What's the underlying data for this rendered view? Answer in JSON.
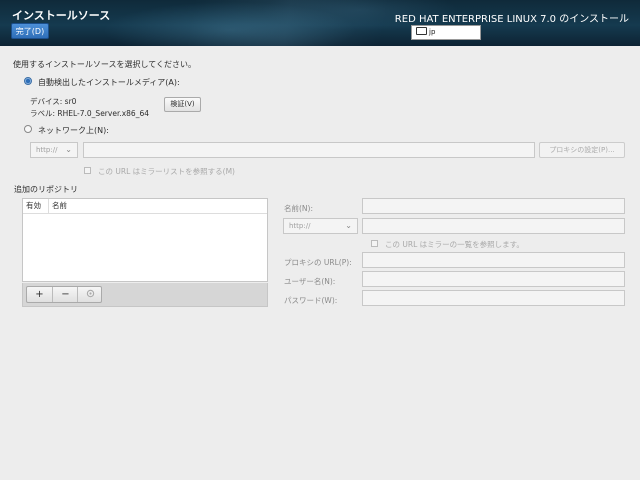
{
  "header": {
    "title": "インストールソース",
    "done_label": "完了(D)",
    "product": "RED HAT ENTERPRISE LINUX 7.0 のインストール",
    "keyboard_layout": "jp"
  },
  "main": {
    "prompt": "使用するインストールソースを選択してください。",
    "auto_media": {
      "label": "自動検出したインストールメディア(A):",
      "selected": true,
      "device": "デバイス: sr0",
      "disc_label": "ラベル: RHEL-7.0_Server.x86_64",
      "verify_label": "検証(V)"
    },
    "network": {
      "label": "ネットワーク上(N):",
      "selected": false,
      "protocol": "http://",
      "url_value": "",
      "proxy_button": "プロキシの設定(P)...",
      "mirror_checkbox_label": "この URL はミラーリストを参照する(M)"
    }
  },
  "repos": {
    "title": "追加のリポジトリ",
    "columns": [
      "有効",
      "名前"
    ],
    "rows": [],
    "add_icon": "+",
    "remove_icon": "−",
    "reset_icon": "reset-icon",
    "form": {
      "name_label": "名前(N):",
      "protocol": "http://",
      "mirror_checkbox_label": "この URL はミラーの一覧を参照します。",
      "proxy_url_label": "プロキシの URL(P):",
      "username_label": "ユーザー名(N):",
      "password_label": "パスワード(W):"
    }
  },
  "colors": {
    "accent": "#2f6fb8",
    "header_bg": "#153a4f",
    "background": "#ededed"
  }
}
